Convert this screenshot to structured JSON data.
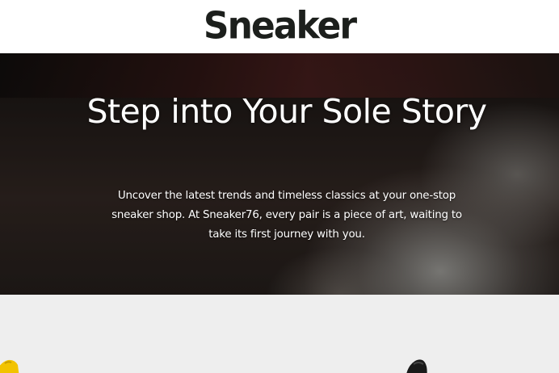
{
  "header": {
    "logo_text": "Sneaker"
  },
  "hero": {
    "title": "Step into Your Sole Story",
    "text": "Uncover the latest trends and timeless classics at your one-stop sneaker shop. At Sneaker76, every pair is a piece of art, waiting to take its first journey with you."
  },
  "products": {
    "colors": {
      "section_background": "#eeeeee",
      "shoe_left": "#f2c300",
      "shoe_right": "#1a1a1a"
    }
  }
}
